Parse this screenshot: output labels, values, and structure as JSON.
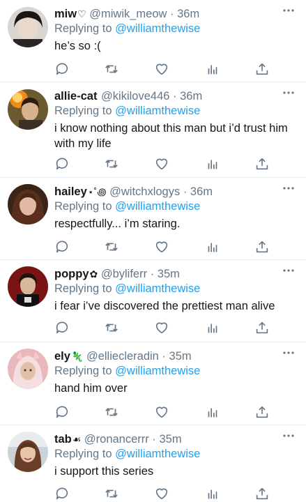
{
  "reply_prefix": "Replying to",
  "separator": "·",
  "colors": {
    "text": "#14171a",
    "secondary": "#657786",
    "link": "#1da1f2",
    "divider": "#e6ecf0"
  },
  "icons": {
    "reply": "reply-icon",
    "retweet": "retweet-icon",
    "like": "heart-icon",
    "analytics": "analytics-icon",
    "share": "share-icon",
    "more": "more-icon"
  },
  "tweets": [
    {
      "name": "miw",
      "name_emoji": "♡",
      "handle": "@miwik_meow",
      "time": "36m",
      "replying_to": "@williamthewise",
      "text": "he’s so :("
    },
    {
      "name": "allie-cat",
      "name_emoji": "",
      "handle": "@kikilove446",
      "time": "36m",
      "replying_to": "@williamthewise",
      "text": "i know nothing about this man but i’d trust him with my life"
    },
    {
      "name": "hailey",
      "name_emoji": "⋆˚꩜",
      "handle": "@witchxlogys",
      "time": "36m",
      "replying_to": "@williamthewise",
      "text": "respectfully... i’m staring."
    },
    {
      "name": "poppy",
      "name_emoji": "✿",
      "handle": "@byliferr",
      "time": "35m",
      "replying_to": "@williamthewise",
      "text": "i fear i’ve discovered the prettiest man alive"
    },
    {
      "name": "ely",
      "name_emoji": "🦎",
      "handle": "@elliecleradin",
      "time": "35m",
      "replying_to": "@williamthewise",
      "text": "hand him over"
    },
    {
      "name": "tab",
      "name_emoji": "☙",
      "handle": "@ronancerrr",
      "time": "35m",
      "replying_to": "@williamthewise",
      "text": "i support this series"
    }
  ]
}
